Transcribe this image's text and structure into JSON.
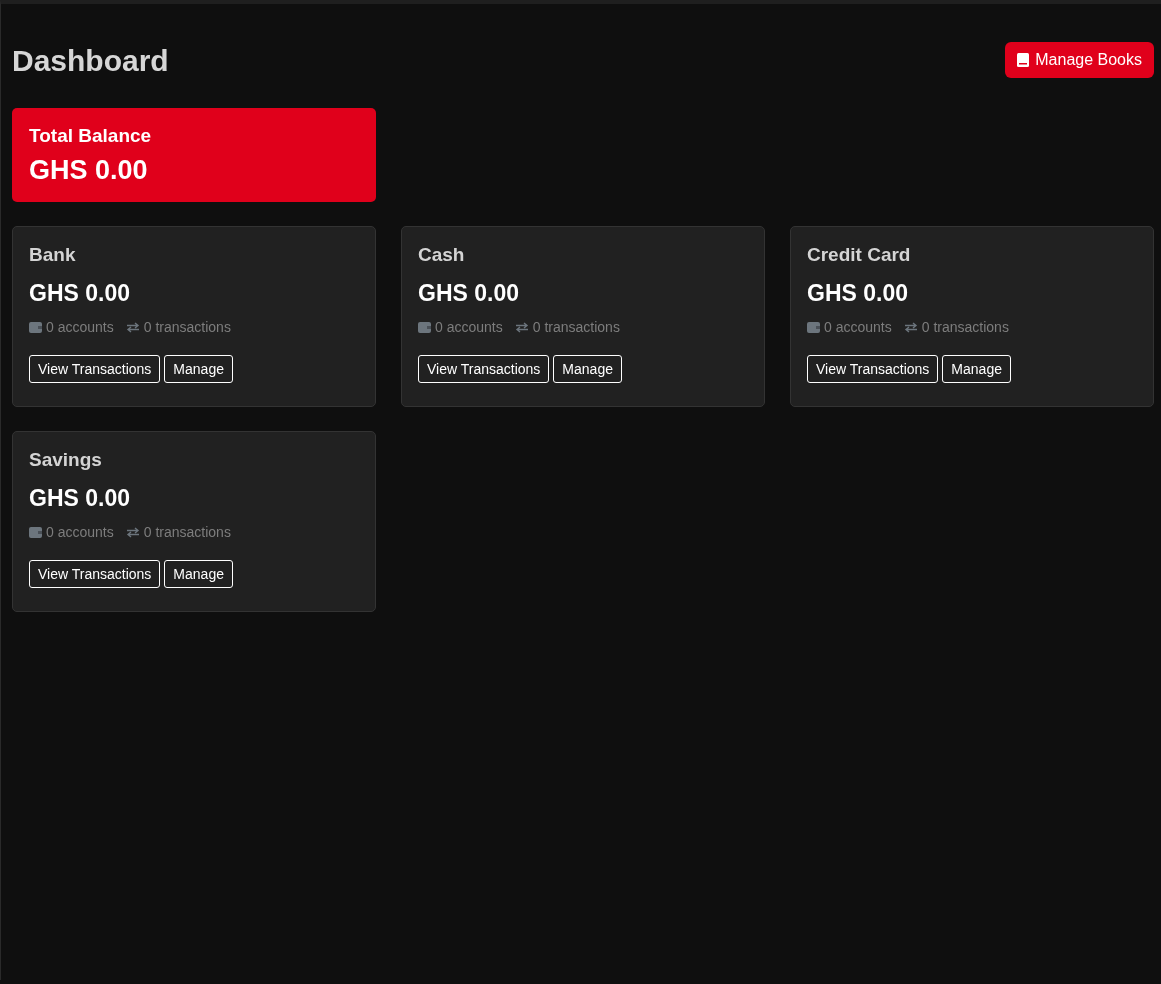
{
  "header": {
    "title": "Dashboard",
    "action": "Manage Books"
  },
  "total": {
    "label": "Total Balance",
    "amount": "GHS 0.00"
  },
  "categories": [
    {
      "name": "Bank",
      "amount": "GHS 0.00",
      "accounts": "0 accounts",
      "transactions": "0 transactions",
      "buttons": [
        "View Transactions",
        "Manage"
      ]
    },
    {
      "name": "Cash",
      "amount": "GHS 0.00",
      "accounts": "0 accounts",
      "transactions": "0 transactions",
      "buttons": [
        "View Transactions",
        "Manage"
      ]
    },
    {
      "name": "Credit Card",
      "amount": "GHS 0.00",
      "accounts": "0 accounts",
      "transactions": "0 transactions",
      "buttons": [
        "View Transactions",
        "Manage"
      ]
    },
    {
      "name": "Savings",
      "amount": "GHS 0.00",
      "accounts": "0 accounts",
      "transactions": "0 transactions",
      "buttons": [
        "View Transactions",
        "Manage"
      ]
    }
  ]
}
